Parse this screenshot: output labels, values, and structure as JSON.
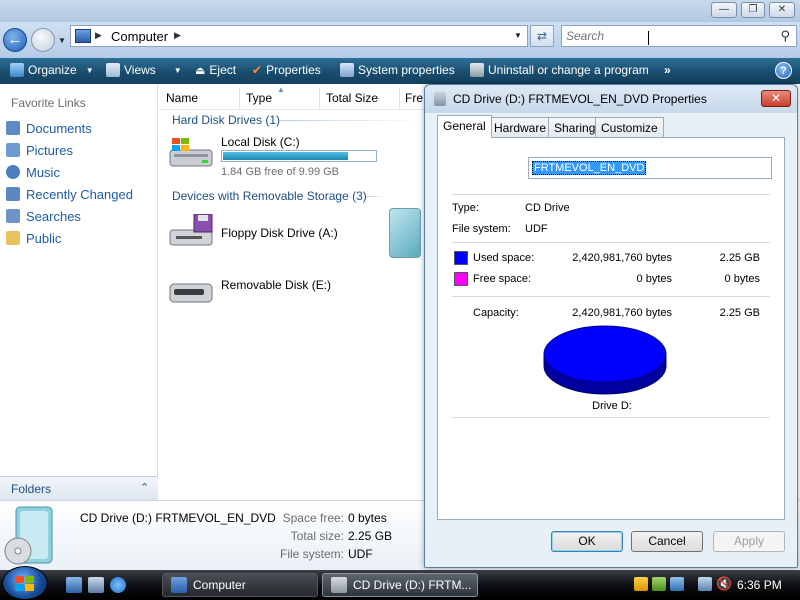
{
  "window": {
    "title_buttons": {
      "minimize": "—",
      "maximize": "❐",
      "close": "✕"
    }
  },
  "address": {
    "path": "Computer",
    "search_placeholder": "Search"
  },
  "commandbar": {
    "organize": "Organize",
    "views": "Views",
    "eject": "Eject",
    "properties": "Properties",
    "system_properties": "System properties",
    "uninstall": "Uninstall or change a program",
    "more": "»"
  },
  "favorites": {
    "header": "Favorite Links",
    "items": [
      {
        "label": "Documents",
        "icon": "documents-icon",
        "color": "#5d8ac4"
      },
      {
        "label": "Pictures",
        "icon": "pictures-icon",
        "color": "#6c9bd1"
      },
      {
        "label": "Music",
        "icon": "music-icon",
        "color": "#4b7fc0"
      },
      {
        "label": "Recently Changed",
        "icon": "recent-icon",
        "color": "#5a88c0"
      },
      {
        "label": "Searches",
        "icon": "searches-icon",
        "color": "#6f95c8"
      },
      {
        "label": "Public",
        "icon": "folder-icon",
        "color": "#e8c25a"
      }
    ],
    "folders_label": "Folders"
  },
  "columns": [
    "Name",
    "Type",
    "Total Size",
    "Fre"
  ],
  "groups": {
    "hdd": "Hard Disk Drives (1)",
    "removable": "Devices with Removable Storage (3)"
  },
  "drives": {
    "local": {
      "name": "Local Disk (C:)",
      "info": "1.84 GB free of 9.99 GB",
      "used_fraction": 0.82
    },
    "floppy": {
      "name": "Floppy Disk Drive (A:)"
    },
    "removable": {
      "name": "Removable Disk (E:)"
    }
  },
  "details": {
    "name": "CD Drive (D:) FRTMEVOL_EN_DVD",
    "space_free_label": "Space free:",
    "space_free": "0 bytes",
    "total_size_label": "Total size:",
    "total_size": "2.25 GB",
    "file_system_label": "File system:",
    "file_system": "UDF"
  },
  "dialog": {
    "title": "CD Drive (D:) FRTMEVOL_EN_DVD Properties",
    "close": "✕",
    "tabs": [
      "General",
      "Hardware",
      "Sharing",
      "Customize"
    ],
    "volume_name": "FRTMEVOL_EN_DVD",
    "type_label": "Type:",
    "type_value": "CD Drive",
    "fs_label": "File system:",
    "fs_value": "UDF",
    "used_label": "Used space:",
    "used_bytes": "2,420,981,760 bytes",
    "used_gb": "2.25 GB",
    "free_label": "Free space:",
    "free_bytes": "0 bytes",
    "free_gb": "0 bytes",
    "capacity_label": "Capacity:",
    "capacity_bytes": "2,420,981,760 bytes",
    "capacity_gb": "2.25 GB",
    "drive_label": "Drive D:",
    "used_color": "#0000ff",
    "free_color": "#ff00ff",
    "buttons": {
      "ok": "OK",
      "cancel": "Cancel",
      "apply": "Apply"
    }
  },
  "taskbar": {
    "buttons": [
      {
        "label": "Computer"
      },
      {
        "label": "CD Drive (D:) FRTM..."
      }
    ],
    "clock": "6:36 PM"
  }
}
